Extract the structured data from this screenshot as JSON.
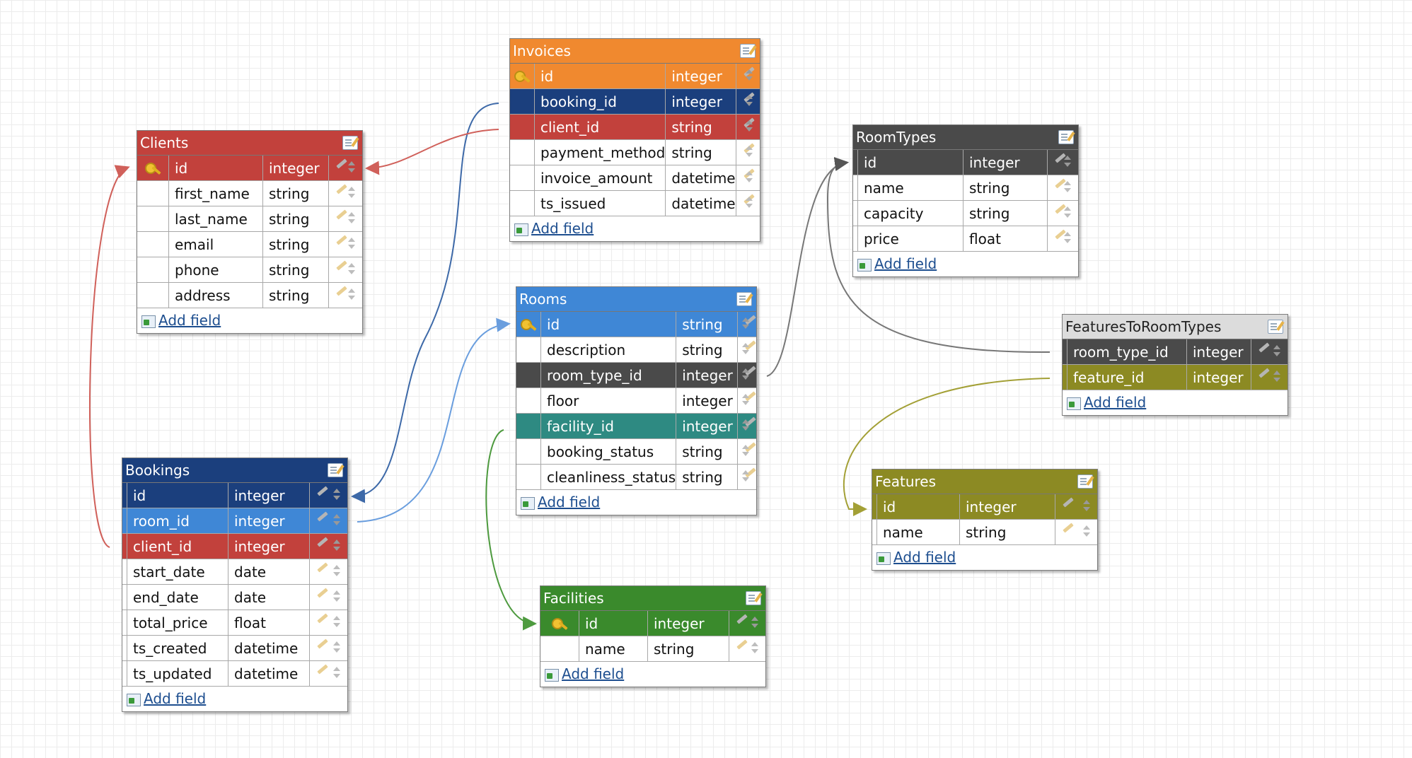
{
  "add_field_label": "Add field",
  "tables": {
    "invoices": {
      "title": "Invoices",
      "color": "#f0892f",
      "fields": [
        {
          "name": "id",
          "type": "integer",
          "key": true,
          "highlight": "#f0892f"
        },
        {
          "name": "booking_id",
          "type": "integer",
          "key": false,
          "highlight": "#1b3f7d"
        },
        {
          "name": "client_id",
          "type": "string",
          "key": false,
          "highlight": "#c2413c"
        },
        {
          "name": "payment_method",
          "type": "string",
          "key": false,
          "highlight": ""
        },
        {
          "name": "invoice_amount",
          "type": "datetime",
          "key": false,
          "highlight": ""
        },
        {
          "name": "ts_issued",
          "type": "datetime",
          "key": false,
          "highlight": ""
        }
      ]
    },
    "clients": {
      "title": "Clients",
      "color": "#c2413c",
      "fields": [
        {
          "name": "id",
          "type": "integer",
          "key": true,
          "highlight": "#c2413c"
        },
        {
          "name": "first_name",
          "type": "string",
          "key": false,
          "highlight": ""
        },
        {
          "name": "last_name",
          "type": "string",
          "key": false,
          "highlight": ""
        },
        {
          "name": "email",
          "type": "string",
          "key": false,
          "highlight": ""
        },
        {
          "name": "phone",
          "type": "string",
          "key": false,
          "highlight": ""
        },
        {
          "name": "address",
          "type": "string",
          "key": false,
          "highlight": ""
        }
      ]
    },
    "roomtypes": {
      "title": "RoomTypes",
      "color": "#4a4a4a",
      "fields": [
        {
          "name": "id",
          "type": "integer",
          "key": false,
          "highlight": "#4a4a4a"
        },
        {
          "name": "name",
          "type": "string",
          "key": false,
          "highlight": ""
        },
        {
          "name": "capacity",
          "type": "string",
          "key": false,
          "highlight": ""
        },
        {
          "name": "price",
          "type": "float",
          "key": false,
          "highlight": ""
        }
      ]
    },
    "rooms": {
      "title": "Rooms",
      "color": "#3f87d6",
      "fields": [
        {
          "name": "id",
          "type": "string",
          "key": true,
          "highlight": "#3f87d6"
        },
        {
          "name": "description",
          "type": "string",
          "key": false,
          "highlight": ""
        },
        {
          "name": "room_type_id",
          "type": "integer",
          "key": false,
          "highlight": "#4a4a4a"
        },
        {
          "name": "floor",
          "type": "integer",
          "key": false,
          "highlight": ""
        },
        {
          "name": "facility_id",
          "type": "integer",
          "key": false,
          "highlight": "#2e8a82"
        },
        {
          "name": "booking_status",
          "type": "string",
          "key": false,
          "highlight": ""
        },
        {
          "name": "cleanliness_status",
          "type": "string",
          "key": false,
          "highlight": ""
        }
      ]
    },
    "featurestoroomtypes": {
      "title": "FeaturesToRoomTypes",
      "color": "#dcdcdc",
      "fields": [
        {
          "name": "room_type_id",
          "type": "integer",
          "key": false,
          "highlight": "#4a4a4a"
        },
        {
          "name": "feature_id",
          "type": "integer",
          "key": false,
          "highlight": "#8c8a23"
        }
      ]
    },
    "bookings": {
      "title": "Bookings",
      "color": "#1b3f7d",
      "fields": [
        {
          "name": "id",
          "type": "integer",
          "key": false,
          "highlight": "#1b3f7d"
        },
        {
          "name": "room_id",
          "type": "integer",
          "key": false,
          "highlight": "#3f87d6"
        },
        {
          "name": "client_id",
          "type": "integer",
          "key": false,
          "highlight": "#c2413c"
        },
        {
          "name": "start_date",
          "type": "date",
          "key": false,
          "highlight": ""
        },
        {
          "name": "end_date",
          "type": "date",
          "key": false,
          "highlight": ""
        },
        {
          "name": "total_price",
          "type": "float",
          "key": false,
          "highlight": ""
        },
        {
          "name": "ts_created",
          "type": "datetime",
          "key": false,
          "highlight": ""
        },
        {
          "name": "ts_updated",
          "type": "datetime",
          "key": false,
          "highlight": ""
        }
      ]
    },
    "features": {
      "title": "Features",
      "color": "#8c8a23",
      "fields": [
        {
          "name": "id",
          "type": "integer",
          "key": false,
          "highlight": "#8c8a23"
        },
        {
          "name": "name",
          "type": "string",
          "key": false,
          "highlight": ""
        }
      ]
    },
    "facilities": {
      "title": "Facilities",
      "color": "#3a8a2c",
      "fields": [
        {
          "name": "id",
          "type": "integer",
          "key": true,
          "highlight": "#3a8a2c"
        },
        {
          "name": "name",
          "type": "string",
          "key": false,
          "highlight": ""
        }
      ]
    }
  },
  "relations": [
    {
      "name": "invoices-booking-to-bookings",
      "color": "#3d69a8"
    },
    {
      "name": "invoices-client-to-clients",
      "color": "#d0605a"
    },
    {
      "name": "bookings-client-to-clients",
      "color": "#d0605a"
    },
    {
      "name": "bookings-room-to-rooms",
      "color": "#6a9ede"
    },
    {
      "name": "rooms-roomtype-to-roomtypes",
      "color": "#777777"
    },
    {
      "name": "ftrt-roomtype-to-roomtypes",
      "color": "#777777"
    },
    {
      "name": "ftrt-feature-to-features",
      "color": "#a3a036"
    },
    {
      "name": "rooms-facility-to-facilities",
      "color": "#4d9a3e"
    }
  ]
}
